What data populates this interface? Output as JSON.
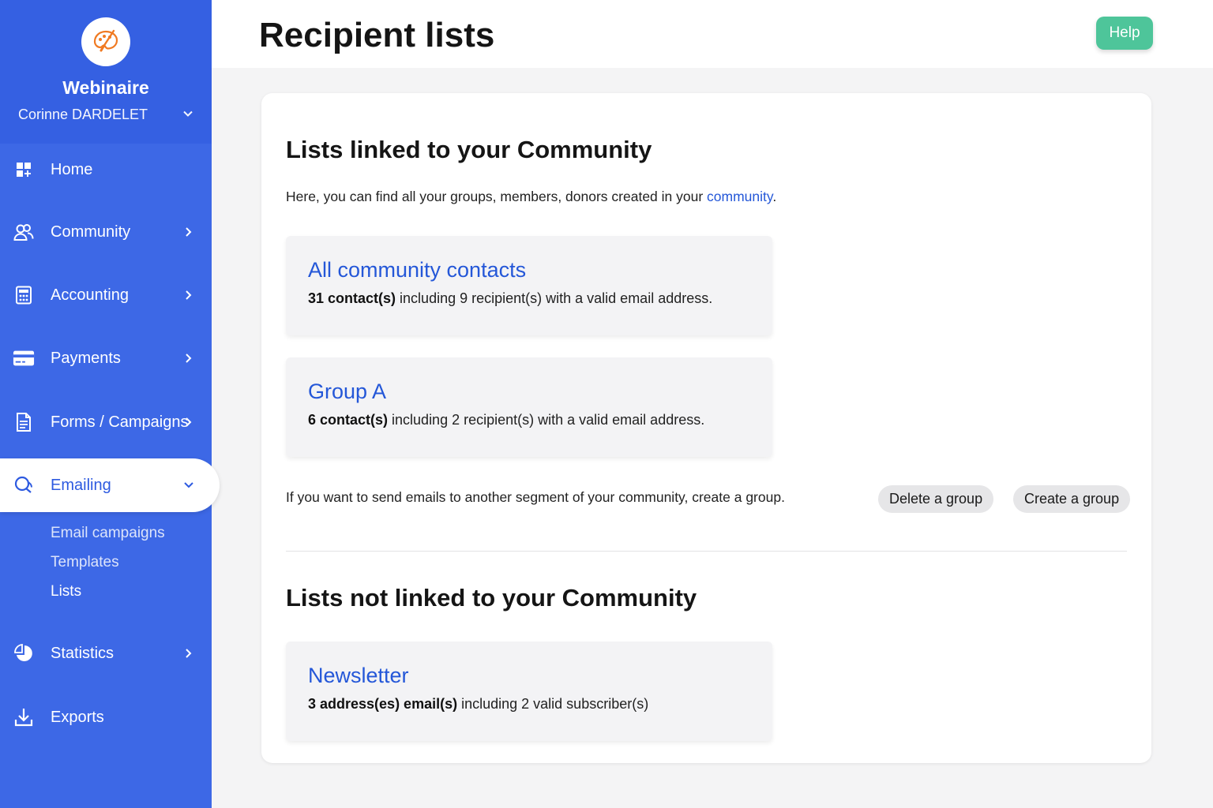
{
  "sidebar": {
    "org_name": "Webinaire",
    "user_name": "Corinne DARDELET",
    "items": [
      {
        "label": "Home",
        "icon": "dashboard-icon"
      },
      {
        "label": "Community",
        "icon": "users-icon"
      },
      {
        "label": "Accounting",
        "icon": "calculator-icon"
      },
      {
        "label": "Payments",
        "icon": "credit-card-icon"
      },
      {
        "label": "Forms / Campaigns",
        "icon": "document-icon"
      },
      {
        "label": "Emailing",
        "icon": "chat-icon"
      },
      {
        "label": "Statistics",
        "icon": "pie-chart-icon"
      },
      {
        "label": "Exports",
        "icon": "download-icon"
      }
    ],
    "emailing_sub": [
      "Email campaigns",
      "Templates",
      "Lists"
    ]
  },
  "header": {
    "title": "Recipient lists",
    "help_label": "Help"
  },
  "linked": {
    "title": "Lists linked to your Community",
    "intro_prefix": "Here, you can find all your groups, members, donors created in your ",
    "intro_link": "community",
    "intro_suffix": ".",
    "lists": [
      {
        "name": "All community contacts",
        "count_bold": "31 contact(s)",
        "rest": " including 9 recipient(s) with a valid email address."
      },
      {
        "name": "Group A",
        "count_bold": "6 contact(s)",
        "rest": " including 2 recipient(s) with a valid email address."
      }
    ],
    "hint": "If you want to send emails to another segment of your community, create a group.",
    "delete_label": "Delete a group",
    "create_label": "Create a group"
  },
  "unlinked": {
    "title": "Lists not linked to your Community",
    "lists": [
      {
        "name": "Newsletter",
        "count_bold": "3 address(es) email(s)",
        "rest": " including 2 valid subscriber(s)"
      }
    ]
  },
  "colors": {
    "sidebar": "#3d68e6",
    "accent_link": "#2457d8",
    "help_button": "#4ec59a"
  }
}
